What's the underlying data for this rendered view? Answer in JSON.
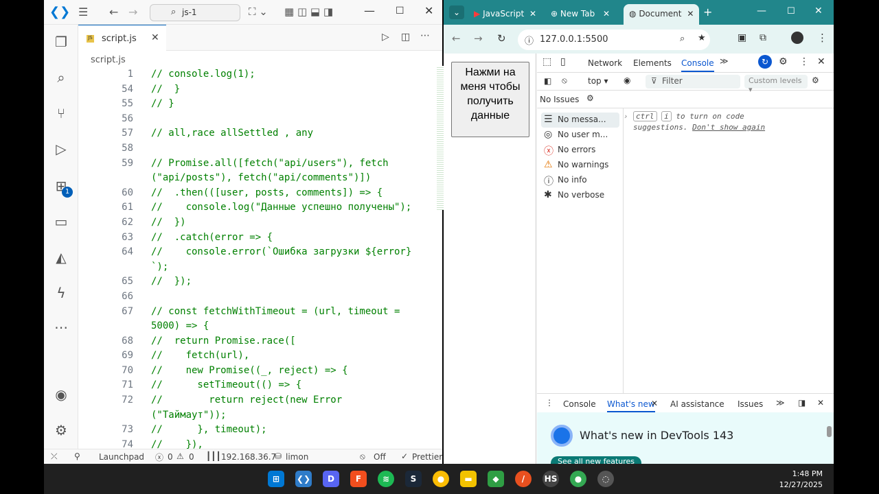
{
  "vscode": {
    "search_text": "js-1",
    "tab_label": "script.js",
    "breadcrumb": "script.js",
    "extensions_badge": "1",
    "line_numbers": [
      "1",
      "54",
      "55",
      "56",
      "57",
      "58",
      "59",
      "",
      "60",
      "61",
      "62",
      "63",
      "64",
      "",
      "65",
      "66",
      "67",
      "",
      "68",
      "69",
      "70",
      "71",
      "72",
      "",
      "73",
      "74"
    ],
    "code_lines": [
      "// console.log(1);",
      "//  }",
      "// }",
      "",
      "// all,race allSettled , any",
      "",
      "// Promise.all([fetch(\"api/users\"), fetch",
      "(\"api/posts\"), fetch(\"api/comments\")])",
      "//  .then(([user, posts, comments]) => {",
      "//    console.log(\"Данные успешно получены\");",
      "//  })",
      "//  .catch(error => {",
      "//    console.error(`Ошибка загрузки ${error}",
      "`);",
      "//  });",
      "",
      "// const fetchWithTimeout = (url, timeout =",
      "5000) => {",
      "//  return Promise.race([",
      "//    fetch(url),",
      "//    new Promise((_, reject) => {",
      "//      setTimeout(() => {",
      "//        return reject(new Error",
      "(\"Таймаут\"));",
      "//      }, timeout);",
      "//    }),"
    ],
    "status": {
      "launchpad": "Launchpad",
      "errors": "0",
      "warnings": "0",
      "ip": "192.168.36.7",
      "db": "limon",
      "off": "Off",
      "prettier": "Prettier"
    }
  },
  "chrome": {
    "tabs": [
      "JavaScript",
      "New Tab",
      "Document"
    ],
    "url": "127.0.0.1:5500",
    "page_button": "Нажми на меня чтобы получить данные",
    "devtools": {
      "tabs": [
        "Network",
        "Elements",
        "Console"
      ],
      "context": "top",
      "filter_placeholder": "Filter",
      "levels": "Custom levels",
      "issues": "No Issues",
      "sidebar": [
        "No messa...",
        "No user m...",
        "No errors",
        "No warnings",
        "No info",
        "No verbose"
      ],
      "hint_key1": "ctrl",
      "hint_key2": "i",
      "hint_text1": "to turn on code",
      "hint_text2": "suggestions.",
      "hint_link": "Don't show again",
      "drawer_tabs": [
        "Console",
        "What's new",
        "AI assistance",
        "Issues"
      ],
      "whats_new_title": "What's new in DevTools 143",
      "see_all": "See all new features"
    }
  },
  "taskbar": {
    "time": "1:48 PM",
    "date": "12/27/2025"
  }
}
